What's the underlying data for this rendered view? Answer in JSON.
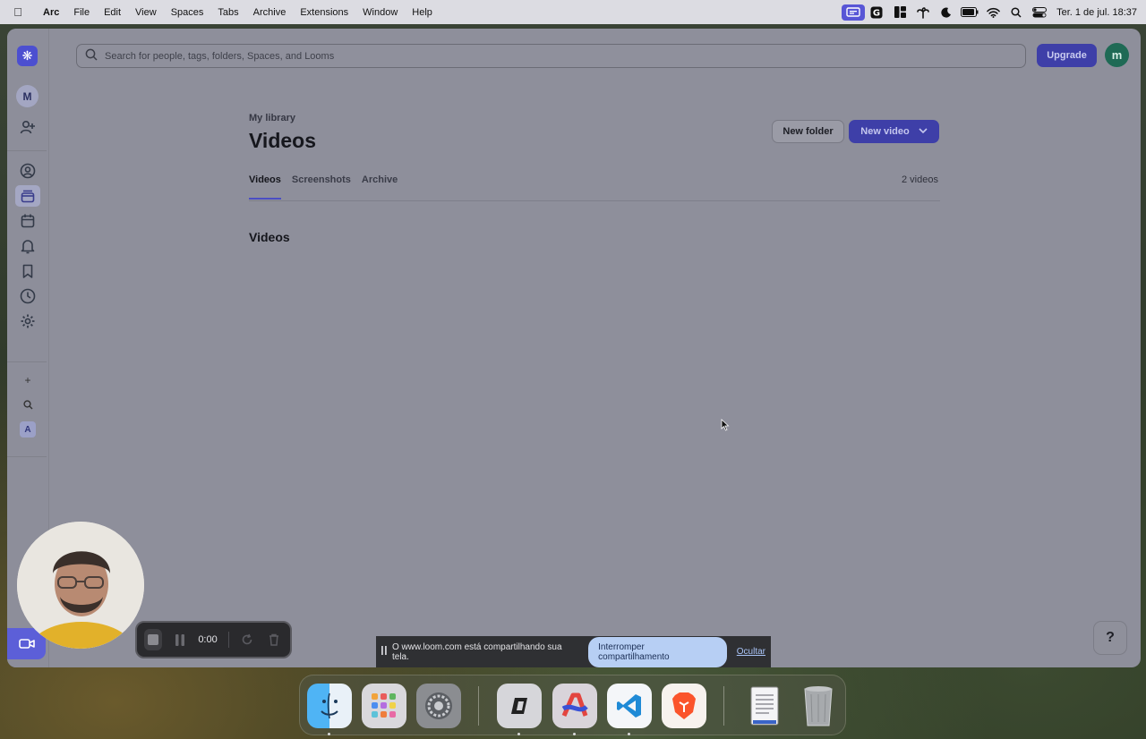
{
  "menubar": {
    "app_name": "Arc",
    "menus": [
      "File",
      "Edit",
      "View",
      "Spaces",
      "Tabs",
      "Archive",
      "Extensions",
      "Window",
      "Help"
    ],
    "clock": "Ter. 1 de jul.  18:37"
  },
  "sidebar": {
    "workspace_initial": "M",
    "workspace_a": "A"
  },
  "header": {
    "search_placeholder": "Search for people, tags, folders, Spaces, and Looms",
    "upgrade_label": "Upgrade",
    "avatar_initial": "m"
  },
  "library": {
    "breadcrumb": "My library",
    "title": "Videos",
    "new_folder_label": "New folder",
    "new_video_label": "New video",
    "tabs": [
      {
        "label": "Videos",
        "active": true
      },
      {
        "label": "Screenshots",
        "active": false
      },
      {
        "label": "Archive",
        "active": false
      }
    ],
    "video_count": "2 videos",
    "section_heading": "Videos"
  },
  "help": {
    "label": "?"
  },
  "recorder": {
    "time": "0:00"
  },
  "share_banner": {
    "message": "O www.loom.com está compartilhando sua tela.",
    "stop_label": "Interromper compartilhamento",
    "hide_label": "Ocultar"
  },
  "colors": {
    "accent": "#3e3fa8",
    "app_background": "#8e8f9b",
    "avatar_green": "#1f6a55",
    "record_tab": "#5c5fd8"
  },
  "dock": {
    "icons": [
      "finder-icon",
      "launchpad-icon",
      "system-settings-icon",
      "parallels-icon",
      "arc-icon",
      "vscode-icon",
      "brave-icon",
      "document-icon",
      "trash-icon"
    ]
  }
}
